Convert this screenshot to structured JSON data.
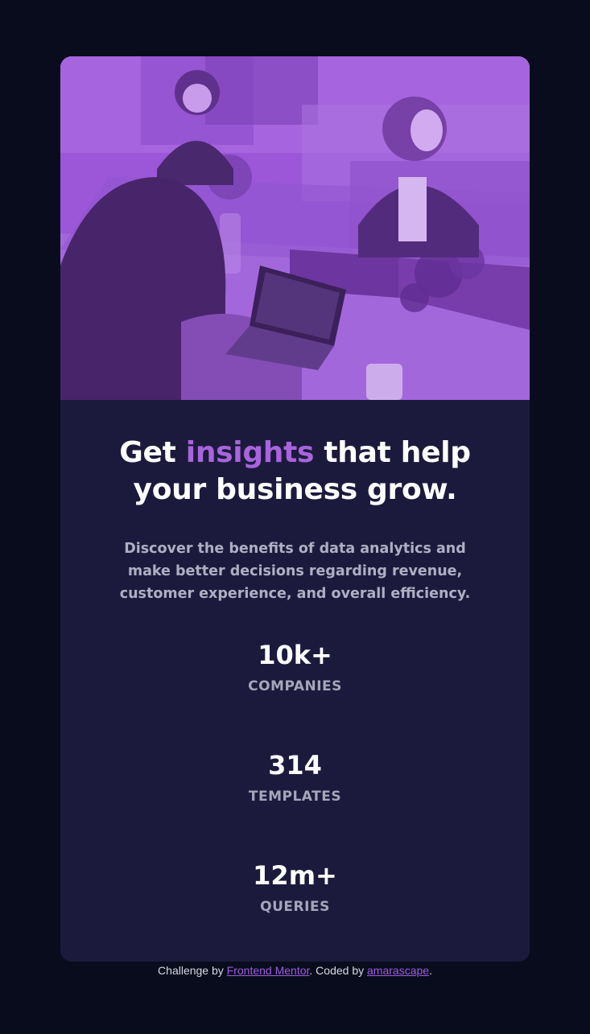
{
  "colors": {
    "background": "#090c1c",
    "card": "#1c1a3c",
    "accent": "#a864dd",
    "text": "#ffffff",
    "muted": "#a6a5ba"
  },
  "hero": {
    "image": "photo-of-three-women-working-at-desks-purple-overlay"
  },
  "headline": {
    "before": "Get ",
    "accent": "insights",
    "after": " that help your business grow."
  },
  "description": "Discover the benefits of data analytics and make better decisions regarding revenue, customer experience, and overall efficiency.",
  "stats": [
    {
      "value": "10k+",
      "label": "COMPANIES"
    },
    {
      "value": "314",
      "label": "TEMPLATES"
    },
    {
      "value": "12m+",
      "label": "QUERIES"
    }
  ],
  "attribution": {
    "prefix": "Challenge by ",
    "link1": "Frontend Mentor",
    "middle": ". Coded by ",
    "link2": "amarascape",
    "suffix": "."
  }
}
